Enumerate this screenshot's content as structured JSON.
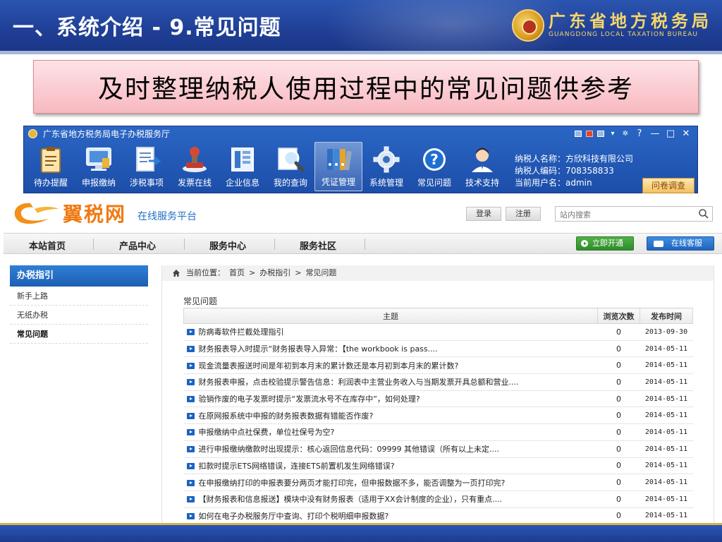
{
  "slide": {
    "title": "一、系统介绍 - 9.常见问题",
    "bureau_cn": "广东省地方税务局",
    "bureau_en": "GUANGDONG LOCAL TAXATION BUREAU",
    "banner": "及时整理纳税人使用过程中的常见问题供参考"
  },
  "app": {
    "title": "广东省地方税务局电子办税服务厅",
    "window_controls": [
      "?",
      "—",
      "□",
      "✕"
    ],
    "toolbar": [
      {
        "label": "待办提醒",
        "icon": "clipboard-icon"
      },
      {
        "label": "申报缴纳",
        "icon": "monitor-icon"
      },
      {
        "label": "涉税事项",
        "icon": "document-icon"
      },
      {
        "label": "发票在线",
        "icon": "stamp-icon"
      },
      {
        "label": "企业信息",
        "icon": "building-icon"
      },
      {
        "label": "我的查询",
        "icon": "magnifier-icon"
      },
      {
        "label": "凭证管理",
        "icon": "binders-icon"
      },
      {
        "label": "系统管理",
        "icon": "gear-icon"
      },
      {
        "label": "常见问题",
        "icon": "question-icon"
      },
      {
        "label": "技术支持",
        "icon": "support-agent-icon"
      }
    ],
    "active_tool": "凭证管理",
    "taxpayer": {
      "name_line": "纳税人名称：方欣科技有限公司",
      "id_line": "纳税人编码：708358833",
      "user_line": "当前用户名：admin"
    },
    "survey_button": "问卷调查"
  },
  "site": {
    "brand_name": "翼税网",
    "brand_tag": "在线服务平台",
    "login": "登录",
    "register": "注册",
    "search_placeholder": "站内搜索",
    "nav": [
      "本站首页",
      "产品中心",
      "服务中心",
      "服务社区"
    ],
    "open_now": "立即开通",
    "online_service": "在线客服",
    "sidebar": {
      "heading": "办税指引",
      "items": [
        "新手上路",
        "无纸办税",
        "常见问题"
      ],
      "current": "常见问题"
    },
    "breadcrumb": {
      "prefix": "当前位置：",
      "home": "首页",
      "section": "办税指引",
      "page": "常见问题",
      "sep": ">"
    },
    "section_title": "常见问题",
    "table": {
      "headers": {
        "subject": "主题",
        "views": "浏览次数",
        "date": "发布时间"
      },
      "rows": [
        {
          "subject": "防病毒软件拦截处理指引",
          "views": "0",
          "date": "2013-09-30"
        },
        {
          "subject": "财务报表导入时提示“财务报表导入异常：【the workbook is pass....",
          "views": "0",
          "date": "2014-05-11"
        },
        {
          "subject": "现金流量表报送时间是年初到本月末的累计数还是本月初到本月末的累计数?",
          "views": "0",
          "date": "2014-05-11"
        },
        {
          "subject": "财务报表申报，点击校验提示警告信息：利润表中主营业务收入与当期发票开具总额和营业....",
          "views": "0",
          "date": "2014-05-11"
        },
        {
          "subject": "验销作废的电子发票时提示“发票流水号不在库存中”，如何处理?",
          "views": "0",
          "date": "2014-05-11"
        },
        {
          "subject": "在原网报系统中申报的财务报表数据有错能否作废?",
          "views": "0",
          "date": "2014-05-11"
        },
        {
          "subject": "申报缴纳中点社保费，单位社保号为空?",
          "views": "0",
          "date": "2014-05-11"
        },
        {
          "subject": "进行申报缴纳缴款时出现提示：核心返回信息代码：09999 其他错误（所有以上未定....",
          "views": "0",
          "date": "2014-05-11"
        },
        {
          "subject": "扣款时提示ETS网络错误，连接ETS前置机发生网络错误?",
          "views": "0",
          "date": "2014-05-11"
        },
        {
          "subject": "在申报缴纳打印的申报表要分两页才能打印完，但申报数据不多，能否调整为一页打印完?",
          "views": "0",
          "date": "2014-05-11"
        },
        {
          "subject": "【财务报表和信息报送】模块中没有财务报表（适用于XX会计制度的企业），只有重点....",
          "views": "0",
          "date": "2014-05-11"
        },
        {
          "subject": "如何在电子办税服务厅中查询、打印个税明细申报数据?",
          "views": "0",
          "date": "2014-05-11"
        }
      ]
    }
  },
  "colors": {
    "slide_blue": "#1f3f96",
    "banner_pink": "#f8b9c0",
    "app_blue": "#2b66c4",
    "brand_orange": "#f07a12",
    "link_blue": "#1b63c2",
    "green": "#2f8a2a"
  }
}
